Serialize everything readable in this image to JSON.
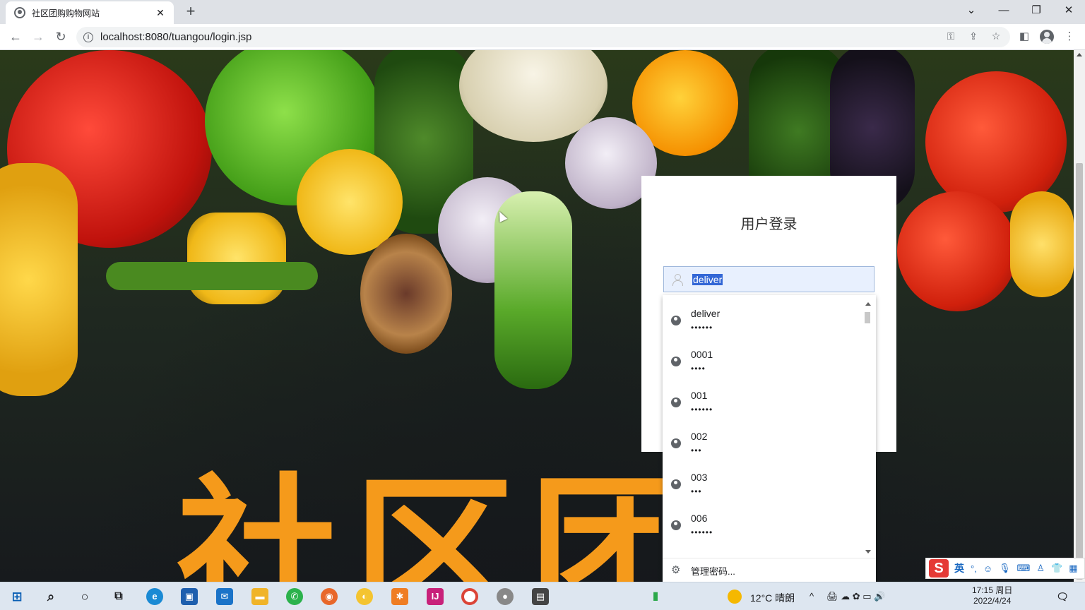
{
  "browser": {
    "tab_title": "社区团购购物网站",
    "url": "localhost:8080/tuangou/login.jsp",
    "new_tab": "+",
    "tab_close": "✕",
    "window_controls": [
      "⌄",
      "—",
      "❐",
      "✕"
    ]
  },
  "page": {
    "banner_text": "社区团购",
    "login": {
      "title": "用户登录",
      "username_value": "deliver"
    }
  },
  "autofill": {
    "entries": [
      {
        "user": "deliver",
        "pass": "••••••"
      },
      {
        "user": "0001",
        "pass": "••••"
      },
      {
        "user": "001",
        "pass": "••••••"
      },
      {
        "user": "002",
        "pass": "•••"
      },
      {
        "user": "003",
        "pass": "•••"
      },
      {
        "user": "006",
        "pass": "••••••"
      }
    ],
    "manage_label": "管理密码..."
  },
  "ime": {
    "mode": "英"
  },
  "taskbar": {
    "weather": "12°C 晴朗",
    "time": "17:15 周日",
    "date": "2022/4/24"
  },
  "colors": {
    "banner_orange": "#f59a1b",
    "chrome_tab_bg": "#dee1e6",
    "autofill_field": "#e8f0fe"
  }
}
